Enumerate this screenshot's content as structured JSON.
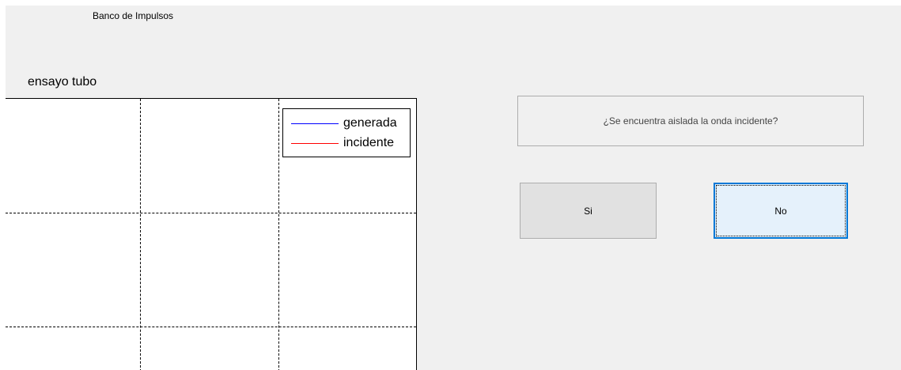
{
  "app": {
    "title": "Banco de Impulsos"
  },
  "plot": {
    "title": "ensayo tubo",
    "legend": [
      {
        "label": "generada",
        "color": "#0000ff"
      },
      {
        "label": "incidente",
        "color": "#ff0000"
      }
    ],
    "grid": true,
    "line_style": "dashed"
  },
  "dialog": {
    "question": "¿Se encuentra aislada la onda incidente?",
    "yes_label": "Si",
    "no_label": "No",
    "focused_button": "No"
  },
  "colors": {
    "window_bg": "#f0f0f0",
    "button_bg": "#e1e1e1",
    "focused_button_bg": "#e5f1fb",
    "focus_border": "#0078d7"
  }
}
